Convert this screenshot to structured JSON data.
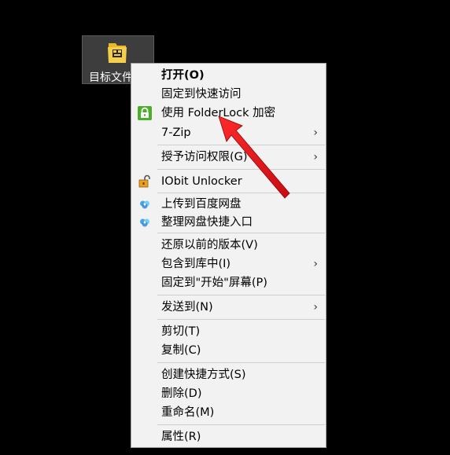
{
  "desktop": {
    "icon_label": "目标文件"
  },
  "menu": {
    "items": [
      {
        "label": "打开(O)"
      },
      {
        "label": "固定到快速访问"
      },
      {
        "label": "使用 FolderLock 加密"
      },
      {
        "label": "7-Zip",
        "arrow": "›"
      },
      {
        "label": "授予访问权限(G)",
        "arrow": "›"
      },
      {
        "label": "IObit Unlocker"
      },
      {
        "label": "上传到百度网盘"
      },
      {
        "label": "整理网盘快捷入口"
      },
      {
        "label": "还原以前的版本(V)"
      },
      {
        "label": "包含到库中(I)",
        "arrow": "›"
      },
      {
        "label": "固定到\"开始\"屏幕(P)"
      },
      {
        "label": "发送到(N)",
        "arrow": "›"
      },
      {
        "label": "剪切(T)"
      },
      {
        "label": "复制(C)"
      },
      {
        "label": "创建快捷方式(S)"
      },
      {
        "label": "删除(D)"
      },
      {
        "label": "重命名(M)"
      },
      {
        "label": "属性(R)"
      }
    ]
  },
  "colors": {
    "annotation_arrow": "#e8141c",
    "menu_background": "#f2f2f2",
    "lock_icon_bg": "#4caf2a"
  }
}
